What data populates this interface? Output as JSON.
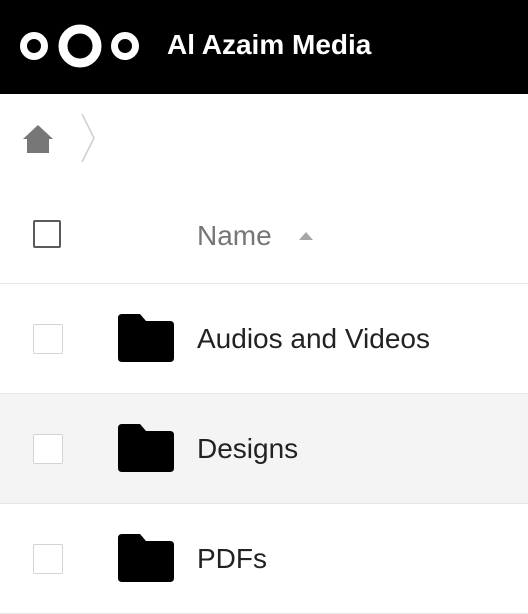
{
  "app": {
    "title": "Al Azaim Media",
    "header_background": "#000000",
    "logo_icon": "nextcloud-logo-icon"
  },
  "breadcrumb": {
    "home_icon": "home-icon",
    "separator_icon": "chevron-right-icon"
  },
  "file_list": {
    "columns": {
      "name_label": "Name",
      "sort_direction": "ascending",
      "sort_icon": "caret-up-icon"
    },
    "rows": [
      {
        "name": "Audios and Videos",
        "type": "folder",
        "icon": "folder-icon",
        "checked": false,
        "hovered": false
      },
      {
        "name": "Designs",
        "type": "folder",
        "icon": "folder-icon",
        "checked": false,
        "hovered": true
      },
      {
        "name": "PDFs",
        "type": "folder",
        "icon": "folder-icon",
        "checked": false,
        "hovered": false
      }
    ]
  },
  "colors": {
    "hover_row": "#f4f4f4",
    "divider": "#e6e6e6",
    "muted_text": "#767676"
  }
}
